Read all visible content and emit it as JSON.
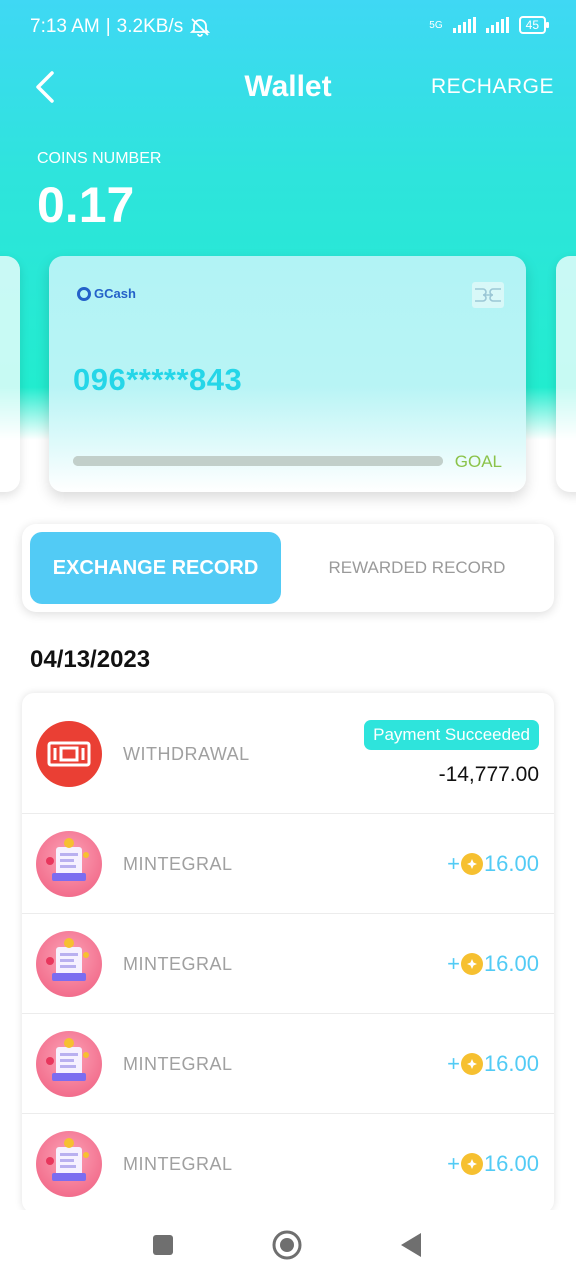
{
  "status_bar": {
    "time": "7:13 AM",
    "separator": "|",
    "speed": "3.2KB/s",
    "network": "5G",
    "battery": "45"
  },
  "app_bar": {
    "title": "Wallet",
    "action": "RECHARGE",
    "back_icon": "chevron-left-icon"
  },
  "wallet": {
    "coins_label": "COINS NUMBER",
    "coins_value": "0.17"
  },
  "card": {
    "brand": "GCash",
    "number": "096*****843",
    "goal_label": "GOAL",
    "goal_progress": 1.0
  },
  "tabs": [
    {
      "label": "EXCHANGE RECORD",
      "active": true
    },
    {
      "label": "REWARDED RECORD",
      "active": false
    }
  ],
  "records": {
    "date": "04/13/2023",
    "items": [
      {
        "type": "withdrawal",
        "name": "WITHDRAWAL",
        "status": "Payment Succeeded",
        "amount": "-14,777.00"
      },
      {
        "type": "reward",
        "name": "MINTEGRAL",
        "sign": "+",
        "amount": "16.00"
      },
      {
        "type": "reward",
        "name": "MINTEGRAL",
        "sign": "+",
        "amount": "16.00"
      },
      {
        "type": "reward",
        "name": "MINTEGRAL",
        "sign": "+",
        "amount": "16.00"
      },
      {
        "type": "reward",
        "name": "MINTEGRAL",
        "sign": "+",
        "amount": "16.00"
      }
    ]
  },
  "colors": {
    "accent": "#52cbf5",
    "teal": "#2ee4dc",
    "goal_green": "#8bc34a",
    "withdraw_red": "#ea3f34",
    "coin_gold": "#f6c030"
  }
}
